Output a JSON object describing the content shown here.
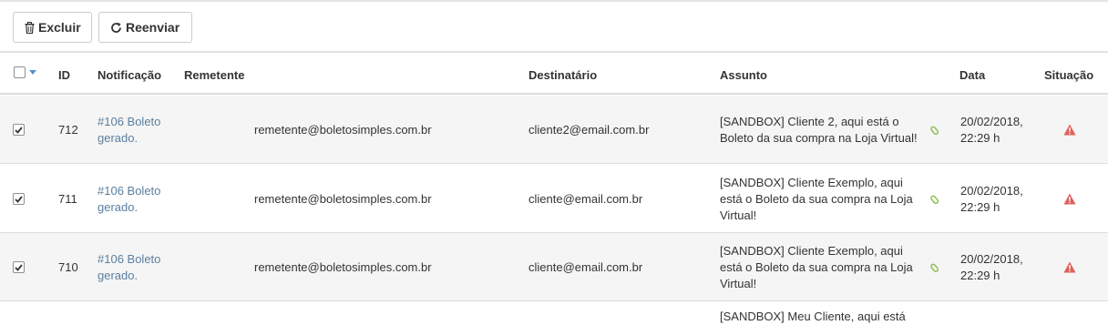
{
  "toolbar": {
    "delete_label": "Excluir",
    "resend_label": "Reenviar"
  },
  "table": {
    "headers": {
      "id": "ID",
      "notification": "Notificação",
      "sender": "Remetente",
      "recipient": "Destinatário",
      "subject": "Assunto",
      "date": "Data",
      "status": "Situação"
    },
    "rows": [
      {
        "checked": true,
        "id": "712",
        "notification": "#106 Boleto gerado.",
        "sender": "remetente@boletosimples.com.br",
        "recipient": "cliente2@email.com.br",
        "subject": "[SANDBOX] Cliente 2, aqui está o Boleto da sua compra na Loja Virtual!",
        "date": "20/02/2018, 22:29 h"
      },
      {
        "checked": true,
        "id": "711",
        "notification": "#106 Boleto gerado.",
        "sender": "remetente@boletosimples.com.br",
        "recipient": "cliente@email.com.br",
        "subject": "[SANDBOX] Cliente Exemplo, aqui está o Boleto da sua compra na Loja Virtual!",
        "date": "20/02/2018, 22:29 h"
      },
      {
        "checked": true,
        "id": "710",
        "notification": "#106 Boleto gerado.",
        "sender": "remetente@boletosimples.com.br",
        "recipient": "cliente@email.com.br",
        "subject": "[SANDBOX] Cliente Exemplo, aqui está o Boleto da sua compra na Loja Virtual!",
        "date": "20/02/2018, 22:29 h"
      }
    ],
    "partial_row_text": "[SANDBOX] Meu Cliente, aqui está"
  },
  "colors": {
    "link": "#5b7f9f",
    "warning": "#e0605a",
    "attachment": "#8cc152",
    "stripe": "#f5f5f5"
  },
  "icons": {
    "delete": "trash-icon",
    "resend": "refresh-icon",
    "attachment": "paperclip-icon",
    "status": "warning-icon",
    "select_menu": "caret-down-icon"
  }
}
